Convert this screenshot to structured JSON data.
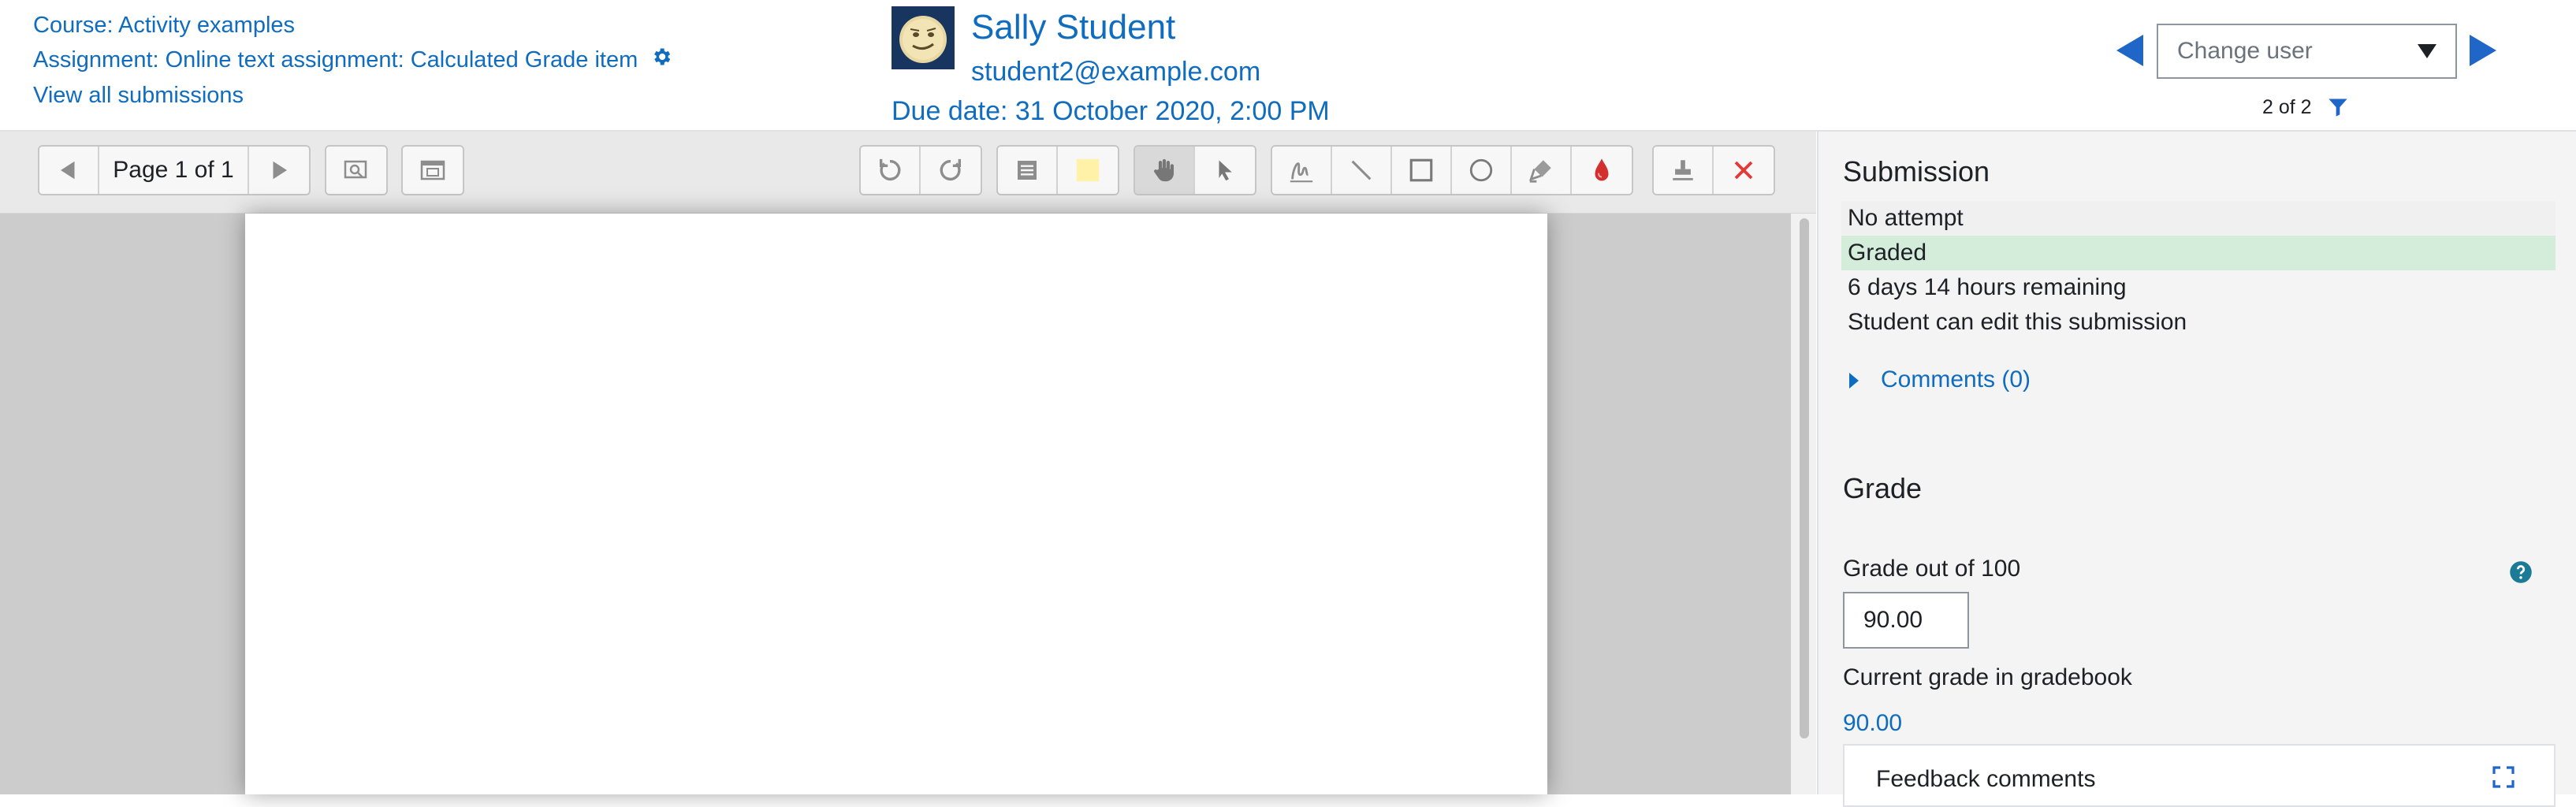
{
  "header": {
    "course_link": "Course: Activity examples",
    "assignment_link": "Assignment: Online text assignment: Calculated Grade item",
    "view_all_link": "View all submissions",
    "user_name": "Sally Student",
    "user_email": "student2@example.com",
    "due_date": "Due date: 31 October 2020, 2:00 PM",
    "change_user_placeholder": "Change user",
    "user_count": "2 of 2"
  },
  "toolbar": {
    "page_label": "Page 1 of 1"
  },
  "panel": {
    "submission_heading": "Submission",
    "status_items": [
      {
        "text": "No attempt",
        "bg": "#f0f0f0"
      },
      {
        "text": "Graded",
        "bg": "#d4edda"
      },
      {
        "text": "6 days 14 hours remaining",
        "bg": "transparent"
      },
      {
        "text": "Student can edit this submission",
        "bg": "transparent"
      }
    ],
    "comments_link": "Comments (0)",
    "grade_heading": "Grade",
    "grade_label": "Grade out of 100",
    "grade_value": "90.00",
    "current_grade_label": "Current grade in gradebook",
    "current_grade_value": "90.00",
    "feedback_label": "Feedback comments"
  },
  "colors": {
    "link": "#0f6cbf",
    "nav_arrow": "#1f66c8",
    "graded_bg": "#d4edda",
    "stamp_delete": "#e53935",
    "stroke_color": "#d32f2f",
    "highlight": "#fff1a8"
  }
}
